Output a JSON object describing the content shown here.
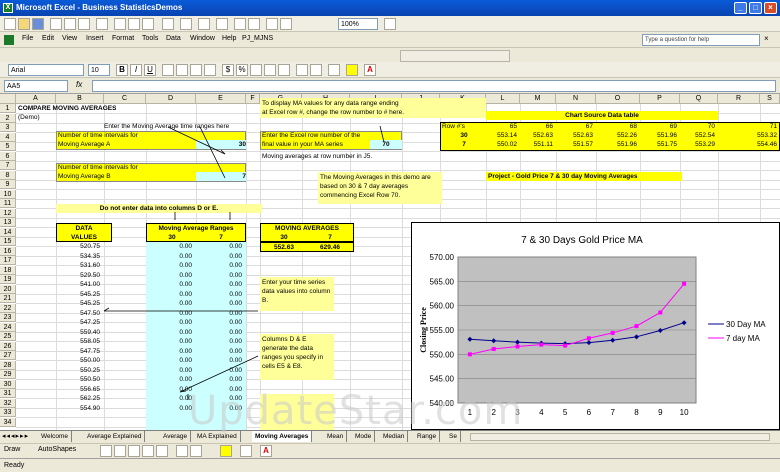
{
  "window": {
    "title": "Microsoft Excel - Business StatisticsDemos"
  },
  "menu": [
    "File",
    "Edit",
    "View",
    "Insert",
    "Format",
    "Tools",
    "Data",
    "Window",
    "Help",
    "PJ_MJNS"
  ],
  "ask_placeholder": "Type a question for help",
  "toolbar": {
    "zoom": "100%",
    "font": "Arial",
    "size": "10",
    "currency": "$",
    "percent": "%"
  },
  "namebox": "AA5",
  "columns": [
    "A",
    "B",
    "C",
    "D",
    "E",
    "F",
    "G",
    "H",
    "I",
    "J",
    "K",
    "L",
    "M",
    "N",
    "O",
    "P",
    "Q",
    "R",
    "S"
  ],
  "rows": [
    "1",
    "2",
    "3",
    "4",
    "5",
    "6",
    "7",
    "8",
    "9",
    "10",
    "11",
    "12",
    "13",
    "14",
    "15",
    "16",
    "17",
    "18",
    "19",
    "20",
    "21",
    "22",
    "23",
    "24",
    "25",
    "26",
    "27",
    "28",
    "29",
    "30",
    "31",
    "32",
    "33",
    "34"
  ],
  "sheet": {
    "title": "COMPARE MOVING AVERAGES",
    "subtitle": "(Demo)",
    "enter_ma_note": "Enter the Moving Average time ranges here",
    "label_a1": "Number of time intervals for",
    "label_a2": "Moving Average A",
    "value_a": "30",
    "label_b1": "Number of time intervals for",
    "label_b2": "Moving Average B",
    "value_b": "7",
    "do_not_enter": "Do not enter data into columns D or E.",
    "data_header1": "DATA",
    "data_header2": "VALUES",
    "ma_ranges_header": "Moving Average Ranges",
    "ma_ranges_30": "30",
    "ma_ranges_7": "7",
    "data_values": [
      "520.75",
      "534.35",
      "531.60",
      "529.50",
      "541.00",
      "545.25",
      "545.25",
      "547.50",
      "547.25",
      "559.40",
      "558.05",
      "547.75",
      "550.00",
      "550.25",
      "550.50",
      "556.65",
      "562.25",
      "554.90"
    ],
    "zero": "0.00",
    "display_note1": "To display MA values for any data range ending",
    "display_note2": "at Excel row #, change the row number to # here.",
    "enter_row1": "Enter the Excel row number of the",
    "enter_row2": "final value in your MA series",
    "row_value": "70",
    "ma_at_row": "Moving averages at row number in J5.",
    "ma_demo_note": "The Moving Averages in this demo are based on 30 & 7 day averages commencing Excel Row 70.",
    "moving_averages_header": "MOVING AVERAGES",
    "ma_head_30": "30",
    "ma_head_7": "7",
    "ma_val_30": "552.63",
    "ma_val_7": "629.46",
    "enter_ts_note": "Enter your time series data values into column B.",
    "cols_de_note": "Columns D & E generate the data ranges you specify in cells E5 & E8.",
    "source_header": "Chart Source Data table",
    "rownums_label": "Row #'s",
    "rownums": [
      "65",
      "66",
      "67",
      "68",
      "69",
      "70",
      "71"
    ],
    "src_30_label": "30",
    "src_30": [
      "553.14",
      "552.63",
      "552.63",
      "552.26",
      "551.96",
      "552.54",
      "553.32"
    ],
    "src_7_label": "7",
    "src_7": [
      "550.02",
      "551.11",
      "551.57",
      "551.96",
      "551.75",
      "553.29",
      "554.46"
    ],
    "project_label": "Project - Gold Price 7 & 30 day Moving Averages"
  },
  "chart_data": {
    "type": "line",
    "title": "7 & 30 Days Gold Price MA",
    "xlabel": "",
    "ylabel": "Closing Price",
    "categories": [
      "1",
      "2",
      "3",
      "4",
      "5",
      "6",
      "7",
      "8",
      "9",
      "10"
    ],
    "ylim": [
      540,
      570
    ],
    "yticks": [
      "540.00",
      "545.00",
      "550.00",
      "555.00",
      "560.00",
      "565.00",
      "570.00"
    ],
    "series": [
      {
        "name": "30 Day MA",
        "color": "#00008b",
        "values": [
          553.1,
          552.8,
          552.5,
          552.3,
          552.2,
          552.4,
          552.9,
          553.6,
          554.9,
          556.5
        ]
      },
      {
        "name": "7 day MA",
        "color": "#ff00ff",
        "values": [
          550.0,
          551.1,
          551.6,
          552.0,
          551.8,
          553.3,
          554.4,
          555.8,
          558.6,
          564.5
        ]
      }
    ],
    "legend": "right"
  },
  "tabs": [
    "Welcome",
    "Average Explained",
    "Average",
    "MA Explained",
    "Moving Averages",
    "Mean",
    "Mode",
    "Median",
    "Range",
    "Se"
  ],
  "active_tab": "Moving Averages",
  "drawbar": {
    "draw": "Draw",
    "autoshapes": "AutoShapes"
  },
  "status": "Ready",
  "watermark": "UpdateStar.com"
}
